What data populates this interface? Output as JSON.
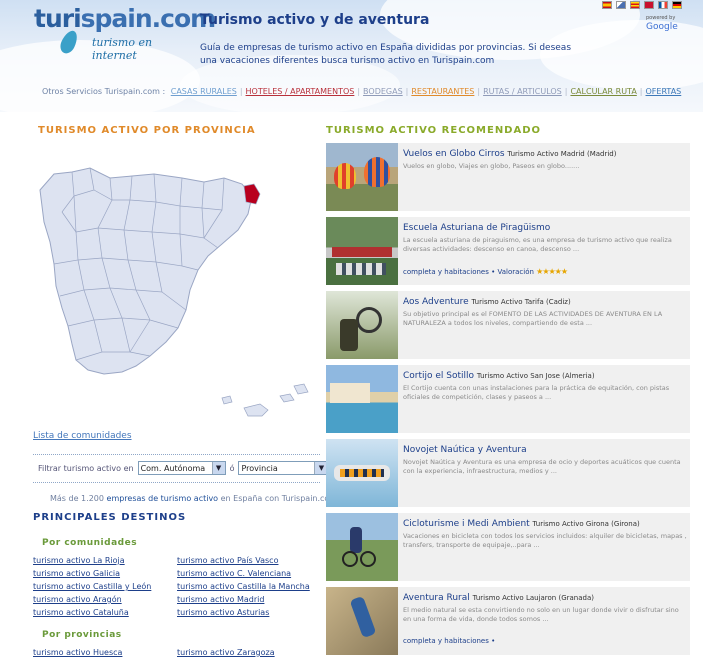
{
  "header": {
    "logo_main": "turi",
    "logo_second": "spain.com",
    "logo_tagline": "turismo en internet",
    "title": "Turismo activo y de aventura",
    "description": "Guía de empresas de turismo activo en España divididas por provincias. Si deseas una vacaciones diferentes busca turismo activo en Turispain.com",
    "google_label": "Google",
    "google_prefix": "powered by"
  },
  "nav": {
    "prefix": "Otros Servicios Turispain.com :",
    "items": [
      {
        "label": "CASAS RURALES",
        "color": "#6f9fd0"
      },
      {
        "label": "HOTELES / APARTAMENTOS",
        "color": "#b8303a"
      },
      {
        "label": "BODEGAS",
        "color": "#8f9bb8"
      },
      {
        "label": "RESTAURANTES",
        "color": "#e08a2a"
      },
      {
        "label": "RUTAS / ARTICULOS",
        "color": "#8f9bb8"
      },
      {
        "label": "CALCULAR RUTA",
        "color": "#7a8a3a"
      },
      {
        "label": "OFERTAS",
        "color": "#3c78b8"
      }
    ]
  },
  "left": {
    "section_title": "TURISMO ACTIVO POR PROVINCIA",
    "map_link": "Lista de comunidades",
    "filter_label": "Filtrar turismo activo en",
    "select1": "Com. Autónoma",
    "or_label": "ó",
    "select2": "Provincia",
    "count_prefix": "Más de 1.200",
    "count_mid": "empresas de turismo activo",
    "count_suffix": "en España con Turispain.com",
    "dest_title": "PRINCIPALES DESTINOS",
    "by_community": "Por comunidades",
    "community_links": [
      "turismo activo La Rioja",
      "turismo activo País Vasco",
      "turismo activo Galicia",
      "turismo activo C. Valenciana",
      "turismo activo Castilla y León",
      "turismo activo Castilla la Mancha",
      "turismo activo Aragón",
      "turismo activo Madrid",
      "turismo activo Cataluña",
      "turismo activo Asturias"
    ],
    "by_province": "Por provincias",
    "province_links": [
      "turismo activo Huesca",
      "turismo activo Zaragoza"
    ]
  },
  "right": {
    "section_title": "TURISMO ACTIVO RECOMENDADO",
    "cards": [
      {
        "title": "Vuelos en Globo Cirros",
        "sub": "Turismo Activo Madrid (Madrid)",
        "desc": "Vuelos en globo, Viajes en globo, Paseos en globo.......",
        "footer": "",
        "rating": ""
      },
      {
        "title": "Escuela Asturiana de Piragüismo",
        "sub": "",
        "desc": "La escuela asturiana de piraguismo, es una empresa de turismo activo que realiza diversas actividades: descenso en canoa, descenso ...",
        "footer": "completa y habitaciones",
        "rating_label": "Valoración",
        "rating": "★★★★★"
      },
      {
        "title": "Aos Adventure",
        "sub": "Turismo Activo Tarifa (Cadiz)",
        "desc": "Su objetivo principal es el FOMENTO DE LAS ACTIVIDADES DE AVENTURA EN LA NATURALEZA a todos los niveles, compartiendo de esta ...",
        "footer": "",
        "rating": ""
      },
      {
        "title": "Cortijo el Sotillo",
        "sub": "Turismo Activo San Jose (Almeria)",
        "desc": "El Cortijo cuenta con unas instalaciones para la práctica de equitación, con pistas oficiales de competición, clases y paseos a ...",
        "footer": "",
        "rating": ""
      },
      {
        "title": "Novojet Naútica y Aventura",
        "sub": "",
        "desc": "Novojet Naútica y Aventura es una empresa de ocio y deportes acuáticos que cuenta con la experiencia, infraestructura, medios y ...",
        "footer": "",
        "rating": ""
      },
      {
        "title": "Cicloturisme i Medi Ambient",
        "sub": "Turismo Activo Girona (Girona)",
        "desc": "Vacaciones en bicicleta con todos los servicios incluidos: alquiler de bicicletas, mapas , transfers, transporte de equipaje,..para ...",
        "footer": "",
        "rating": ""
      },
      {
        "title": "Aventura Rural",
        "sub": "Turismo Activo Laujaron (Granada)",
        "desc": "El medio natural se esta convirtiendo no solo en un lugar donde vivir o disfrutar sino en una forma de vida, donde todos somos ...",
        "footer": "completa y habitaciones",
        "rating": ""
      }
    ]
  },
  "colors": {
    "navy": "#1d3f8a",
    "orange": "#e08a2a",
    "green": "#8aaa2a",
    "map_fill": "#dde3f1",
    "map_stroke": "#9aa6c4",
    "highlight": "#b8001e"
  }
}
